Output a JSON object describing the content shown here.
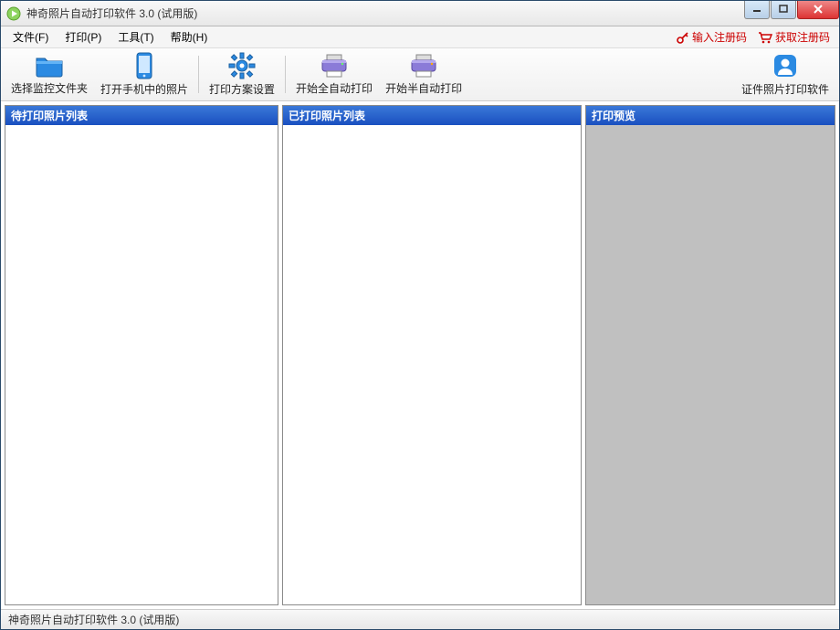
{
  "window": {
    "title": "神奇照片自动打印软件 3.0 (试用版)"
  },
  "menubar": {
    "items": [
      {
        "label": "文件(F)"
      },
      {
        "label": "打印(P)"
      },
      {
        "label": "工具(T)"
      },
      {
        "label": "帮助(H)"
      }
    ],
    "links": [
      {
        "label": "输入注册码",
        "icon": "key-icon"
      },
      {
        "label": "获取注册码",
        "icon": "cart-icon"
      }
    ]
  },
  "toolbar": {
    "items": [
      {
        "label": "选择监控文件夹",
        "icon": "folder-icon"
      },
      {
        "label": "打开手机中的照片",
        "icon": "phone-icon"
      },
      {
        "sep": true
      },
      {
        "label": "打印方案设置",
        "icon": "gear-icon"
      },
      {
        "sep": true
      },
      {
        "label": "开始全自动打印",
        "icon": "printer-auto-icon"
      },
      {
        "label": "开始半自动打印",
        "icon": "printer-semi-icon"
      }
    ],
    "right": {
      "label": "证件照片打印软件",
      "icon": "id-photo-icon"
    }
  },
  "panels": {
    "pending": {
      "title": "待打印照片列表"
    },
    "printed": {
      "title": "已打印照片列表"
    },
    "preview": {
      "title": "打印预览"
    }
  },
  "statusbar": {
    "text": "神奇照片自动打印软件 3.0 (试用版)"
  }
}
